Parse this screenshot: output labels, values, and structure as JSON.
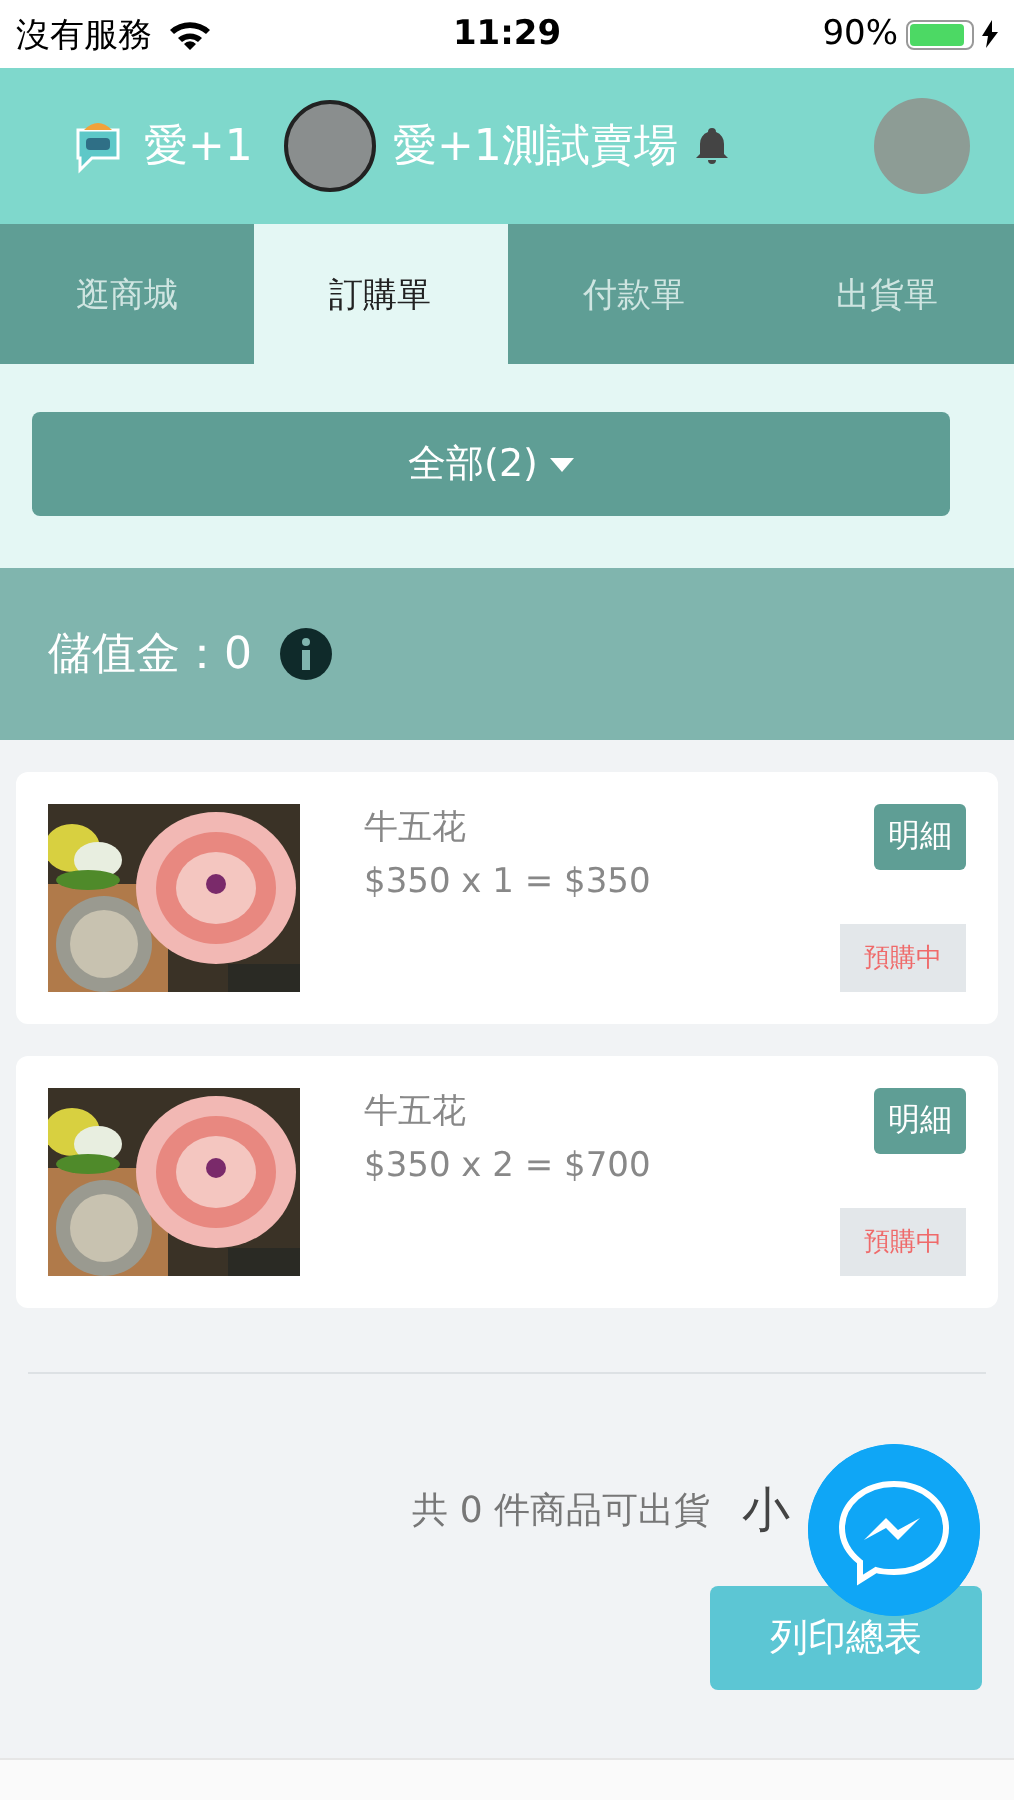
{
  "status_bar": {
    "carrier": "沒有服務",
    "time": "11:29",
    "battery": "90%"
  },
  "header": {
    "app_name": "愛+1",
    "store_name": "愛+1測試賣場"
  },
  "tabs": [
    {
      "label": "逛商城",
      "selected": false
    },
    {
      "label": "訂購單",
      "selected": true
    },
    {
      "label": "付款單",
      "selected": false
    },
    {
      "label": "出貨單",
      "selected": false
    }
  ],
  "filter": {
    "label": "全部(2)"
  },
  "balance": {
    "label": "儲值金：0"
  },
  "orders": [
    {
      "name": "牛五花",
      "price_line": "$350 x 1 = $350",
      "detail_button": "明細",
      "status": "預購中"
    },
    {
      "name": "牛五花",
      "price_line": "$350 x 2 = $700",
      "detail_button": "明細",
      "status": "預購中"
    }
  ],
  "footer": {
    "summary": "共 0 件商品可出貨",
    "subtotal": "小",
    "print_button": "列印總表"
  }
}
